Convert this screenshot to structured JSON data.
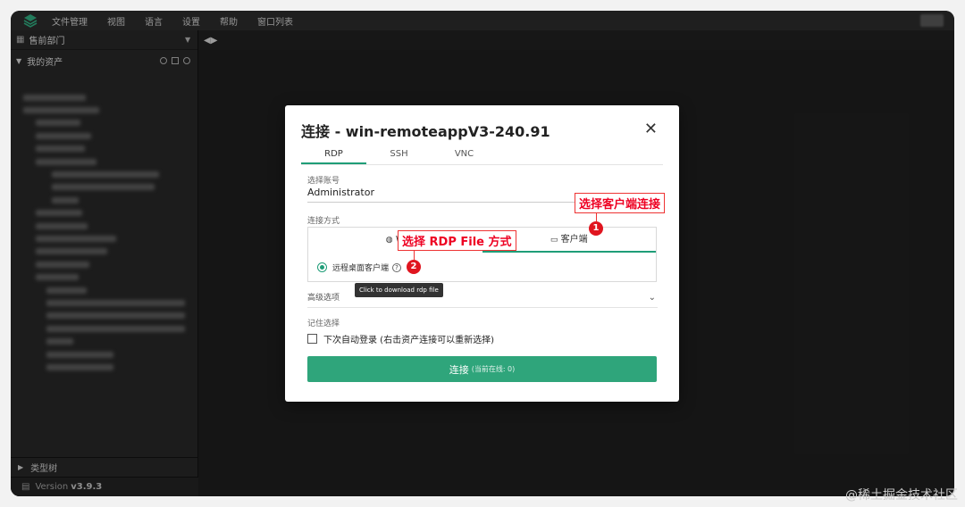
{
  "menubar": {
    "items": [
      "文件管理",
      "视图",
      "语言",
      "设置",
      "帮助",
      "窗口列表"
    ]
  },
  "sidebar": {
    "department": "售前部门",
    "my_assets": "我的资产",
    "type_tree": "类型树",
    "version_label": "Version",
    "version_value": "v3.9.3"
  },
  "dialog": {
    "title": "连接 - win-remoteappV3-240.91",
    "tabs": [
      "RDP",
      "SSH",
      "VNC"
    ],
    "account_label": "选择账号",
    "account_value": "Administrator",
    "method_label": "连接方式",
    "method_tabs": [
      "W",
      "客户端"
    ],
    "radio_label": "远程桌面客户端",
    "tooltip": "Click to download rdp file",
    "advanced_label": "高级选项",
    "remember_label": "记住选择",
    "auto_login_label": "下次自动登录 (右击资产连接可以重新选择)",
    "connect_label": "连接",
    "connect_sub": "(当前在线: 0)"
  },
  "annotations": {
    "callout1": "选择客户端连接",
    "callout2": "选择 RDP File 方式",
    "num1": "1",
    "num2": "2"
  },
  "watermark": "@稀土掘金技术社区",
  "colors": {
    "accent": "#2fa57b",
    "annotation": "#e0151f"
  }
}
